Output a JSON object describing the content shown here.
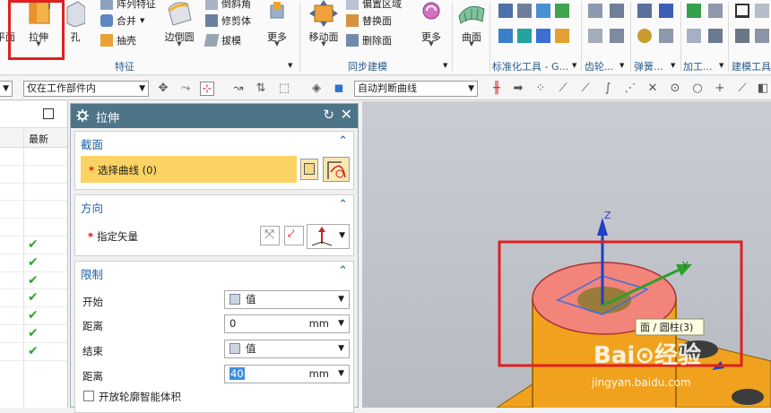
{
  "ribbon": {
    "left_cut_label": "平面",
    "extrude_label": "拉伸",
    "hole_label": "孔",
    "pattern_feature_label": "阵列特征",
    "unite_label": "合并",
    "shell_label": "抽壳",
    "edge_blend_label": "边倒圆",
    "chamfer_label": "倒斜角",
    "trim_body_label": "修剪体",
    "draft_label": "拔模",
    "more1_label": "更多",
    "feature_group_label": "特征",
    "move_face_label": "移动面",
    "offset_region_label": "偏置区域",
    "replace_face_label": "替换面",
    "delete_face_label": "删除面",
    "more2_label": "更多",
    "sync_group_label": "同步建模",
    "surface_label": "曲面",
    "std_tools_label": "标准化工具 - G...",
    "gear_label": "齿轮...",
    "spring_label": "弹簧...",
    "machining_label": "加工...",
    "build_tools_label": "建模工具"
  },
  "toolbar": {
    "scope_value": "仅在工作部件内",
    "curve_rule_value": "自动判断曲线"
  },
  "nav": {
    "column_header": "最新",
    "rows": [
      false,
      false,
      false,
      false,
      false,
      true,
      true,
      true,
      true,
      true,
      true,
      true
    ]
  },
  "dialog": {
    "title": "拉伸",
    "section": {
      "title": "截面",
      "select_curve": "选择曲线 (0)"
    },
    "direction": {
      "title": "方向",
      "specify_vector": "指定矢量"
    },
    "limits": {
      "title": "限制",
      "start_label": "开始",
      "start_value": "值",
      "start_distance_label": "距离",
      "start_distance": "0",
      "end_label": "结束",
      "end_value": "值",
      "end_distance_label": "距离",
      "end_distance": "40",
      "unit": "mm",
      "open_profile_label": "开放轮廓智能体积"
    }
  },
  "viewport": {
    "axis_z": "Z",
    "axis_y": "Y",
    "tooltip": "面 / 圆柱(3)",
    "watermark_text": "Bai⊙经验",
    "watermark_url": "jingyan.baidu.com"
  },
  "colors": {
    "title_bar": "#4d7487",
    "highlight_box": "#e02020",
    "face_highlight": "#f2847a",
    "part_orange": "#f0a21e",
    "selection_yellow": "#fbd364",
    "section_blue": "#1d5fa0"
  }
}
